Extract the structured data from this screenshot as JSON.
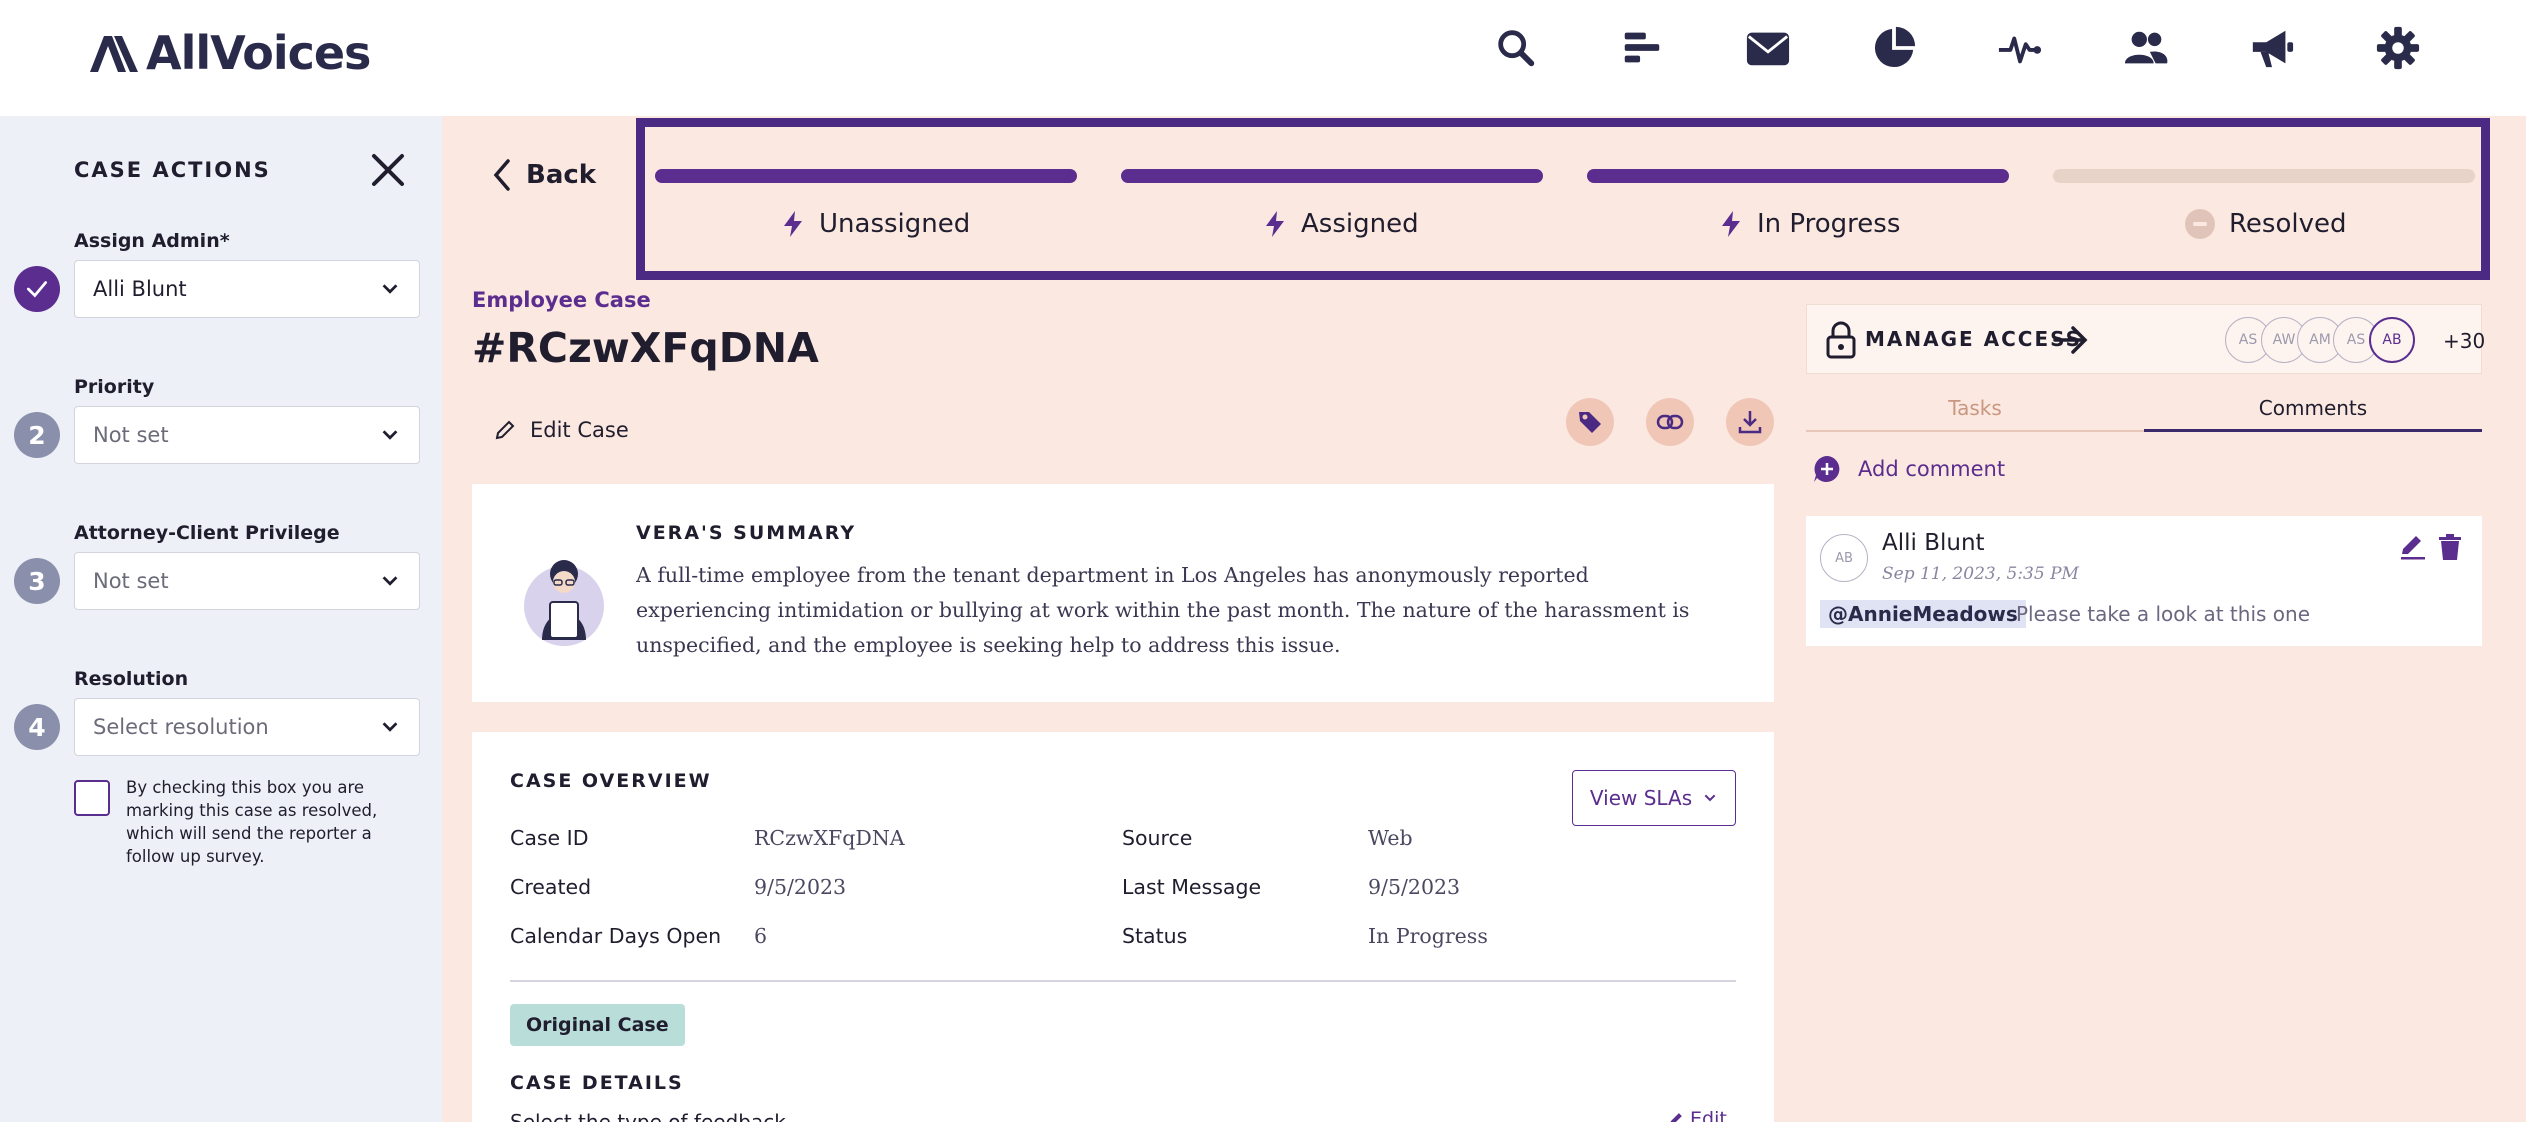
{
  "brand": {
    "name": "AllVoices"
  },
  "nav": {
    "icons": [
      "search-icon",
      "bars-icon",
      "mail-icon",
      "pie-chart-icon",
      "activity-icon",
      "users-icon",
      "megaphone-icon",
      "gear-icon"
    ]
  },
  "sidebar": {
    "title": "CASE ACTIONS",
    "assign": {
      "label": "Assign Admin*",
      "value": "Alli Blunt"
    },
    "priority": {
      "step": "2",
      "label": "Priority",
      "value": "Not set"
    },
    "privilege": {
      "step": "3",
      "label": "Attorney-Client Privilege",
      "value": "Not set"
    },
    "resolution": {
      "step": "4",
      "label": "Resolution",
      "placeholder": "Select resolution"
    },
    "checkbox_text": "By checking this box you are marking this case as resolved, which will send the reporter a follow up survey."
  },
  "back_label": "Back",
  "progress": {
    "stages": [
      {
        "label": "Unassigned",
        "complete": true
      },
      {
        "label": "Assigned",
        "complete": true
      },
      {
        "label": "In Progress",
        "complete": true
      },
      {
        "label": "Resolved",
        "complete": false
      }
    ]
  },
  "case": {
    "kind": "Employee Case",
    "id_title": "#RCzwXFqDNA",
    "edit_label": "Edit Case"
  },
  "summary": {
    "title": "VERA'S SUMMARY",
    "text": "A full-time employee from the tenant department in Los Angeles has anonymously reported experiencing intimidation or bullying at work within the past month. The nature of the harassment is unspecified, and the employee is seeking help to address this issue."
  },
  "overview": {
    "title": "CASE OVERVIEW",
    "view_slas": "View SLAs",
    "case_id_label": "Case ID",
    "case_id": "RCzwXFqDNA",
    "source_label": "Source",
    "source": "Web",
    "created_label": "Created",
    "created": "9/5/2023",
    "last_message_label": "Last Message",
    "last_message": "9/5/2023",
    "days_open_label": "Calendar Days Open",
    "days_open": "6",
    "status_label": "Status",
    "status": "In Progress",
    "original_badge": "Original Case",
    "details_title": "CASE DETAILS",
    "details_sub": "Select the type of feedback",
    "details_edit": "Edit"
  },
  "access": {
    "label": "MANAGE ACCESS",
    "avatars": [
      "AS",
      "AW",
      "AM",
      "AS",
      "AB"
    ],
    "more": "+30"
  },
  "tabs": {
    "tasks": "Tasks",
    "comments": "Comments"
  },
  "add_comment": "Add comment",
  "comment": {
    "initials": "AB",
    "author": "Alli Blunt",
    "date": "Sep 11, 2023, 5:35 PM",
    "mention": "@AnnieMeadows",
    "text": "Please take a look at this one"
  },
  "colors": {
    "accent": "#5b2d8f",
    "page_bg": "#fbe8e0",
    "sidebar_bg": "#eef0f7",
    "progress_border": "#4b2a83"
  }
}
